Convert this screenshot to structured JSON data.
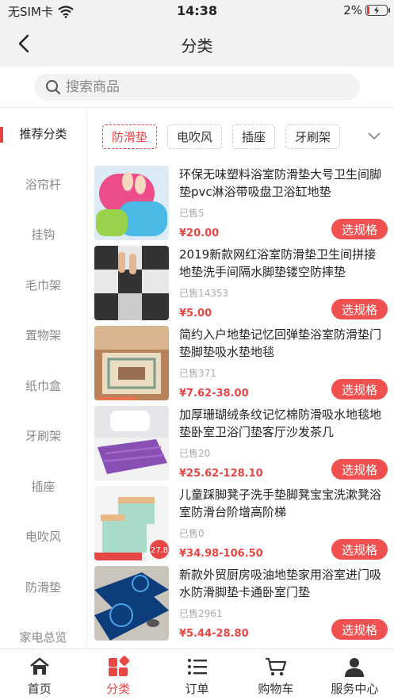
{
  "status_bar": {
    "carrier": "无SIM卡",
    "time": "14:38",
    "battery": "2%"
  },
  "nav": {
    "title": "分类"
  },
  "search": {
    "placeholder": "搜索商品"
  },
  "sidebar": {
    "items": [
      "推荐分类",
      "浴帘杆",
      "挂钩",
      "毛巾架",
      "置物架",
      "纸巾盒",
      "牙刷架",
      "插座",
      "电吹风",
      "防滑垫",
      "家电总览"
    ],
    "active_index": 0
  },
  "tabs": {
    "items": [
      "防滑垫",
      "电吹风",
      "插座",
      "牙刷架"
    ],
    "active_index": 0
  },
  "products": [
    {
      "title": "环保无味塑料浴室防滑垫大号卫生间脚垫pvc淋浴带吸盘卫浴缸地垫",
      "sold": "已售5",
      "price": "¥20.00",
      "button": "选规格"
    },
    {
      "title": "2019新款网红浴室防滑垫卫生间拼接地垫洗手间隔水脚垫镂空防摔垫",
      "sold": "已售14353",
      "price": "¥5.00",
      "button": "选规格"
    },
    {
      "title": "简约入户地垫记忆回弹垫浴室防滑垫门垫脚垫吸水垫地毯",
      "sold": "已售371",
      "price": "¥7.62-38.00",
      "button": "选规格"
    },
    {
      "title": "加厚珊瑚绒条纹记忆棉防滑吸水地毯地垫卧室卫浴门垫客厅沙发茶几",
      "sold": "已售20",
      "price": "¥25.62-128.10",
      "button": "选规格"
    },
    {
      "title": "儿童踩脚凳子洗手垫脚凳宝宝洗漱凳浴室防滑台阶增高阶梯",
      "sold": "已售0",
      "price": "¥34.98-106.50",
      "button": "选规格",
      "thumb_badge": "27.8"
    },
    {
      "title": "新款外贸厨房吸油地垫家用浴室进门吸水防滑脚垫卡通卧室门垫",
      "sold": "已售2961",
      "price": "¥5.44-28.80",
      "button": "选规格"
    }
  ],
  "tabbar": {
    "items": [
      "首页",
      "分类",
      "订单",
      "购物车",
      "服务中心"
    ],
    "active_index": 1
  },
  "colors": {
    "accent": "#e84545",
    "button": "#f0504f"
  }
}
